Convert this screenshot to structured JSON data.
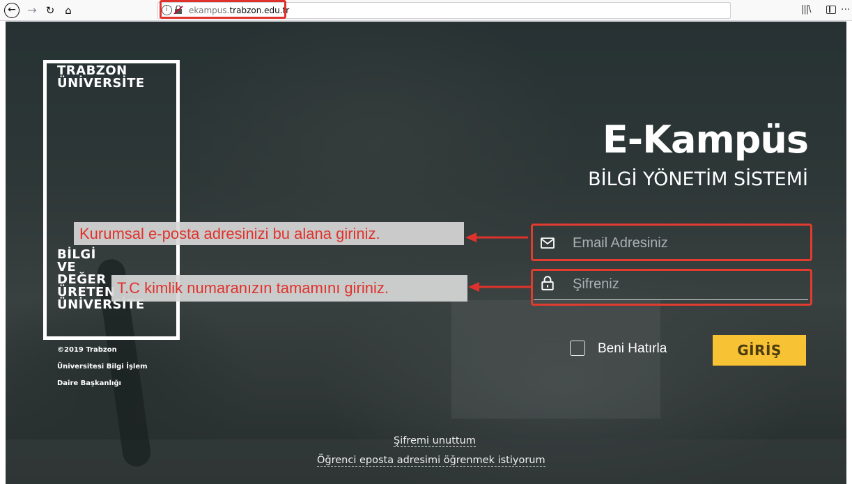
{
  "browser": {
    "url_host_prefix": "ekampus.",
    "url_host_main": "trabzon.edu.tr",
    "icons": [
      "back-icon",
      "forward-icon",
      "reload-icon",
      "home-icon",
      "info-icon",
      "insecure-lock-icon",
      "more-icon",
      "pocket-icon",
      "star-icon",
      "library-icon",
      "sidebar-icon"
    ]
  },
  "logo": {
    "top_lines": [
      "TRABZON",
      "ÜNİVERSİTE"
    ],
    "bottom_lines": [
      "BİLGİ",
      "VE",
      "DEĞER",
      "ÜRETEN",
      "ÜNİVERSİTE"
    ]
  },
  "footer_copyright": {
    "line1": "©2019 Trabzon",
    "line2": "Üniversitesi Bilgi İşlem",
    "line3": "Daire Başkanlığı"
  },
  "header": {
    "title": "E-Kampüs",
    "subtitle": "BİLGİ YÖNETİM SİSTEMİ"
  },
  "form": {
    "email_placeholder": "Email Adresiniz",
    "password_placeholder": "Şifreniz",
    "remember_label": "Beni Hatırla",
    "login_label": "GİRİŞ"
  },
  "annotations": {
    "email_hint": "Kurumsal e-posta adresinizi bu alana giriniz.",
    "password_hint": "T.C kimlik numaranızın tamamını giriniz."
  },
  "links": {
    "forgot_password": "Şifremi unuttum",
    "student_email": "Öğrenci eposta adresimi öğrenmek istiyorum"
  },
  "colors": {
    "annotation_red": "#e0322c",
    "login_yellow": "#f7c233"
  }
}
